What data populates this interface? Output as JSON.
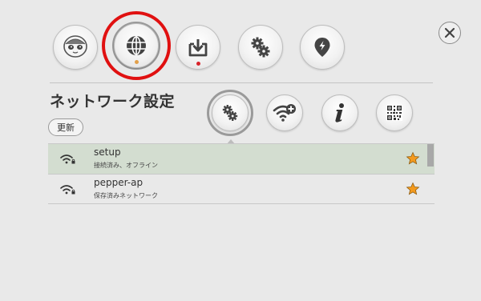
{
  "top_nav": {
    "items": [
      {
        "icon": "robot-face-icon"
      },
      {
        "icon": "globe-icon"
      },
      {
        "icon": "download-icon"
      },
      {
        "icon": "gears-icon"
      },
      {
        "icon": "map-pin-bolt-icon"
      }
    ],
    "close_icon": "close-icon"
  },
  "page": {
    "title": "ネットワーク設定"
  },
  "toolbar": {
    "update_label": "更新",
    "icons": [
      "gears-icon",
      "wifi-add-icon",
      "info-icon",
      "qr-code-icon"
    ]
  },
  "networks": [
    {
      "name": "setup",
      "status": "接続済み、オフライン",
      "favorite": true,
      "selected": true
    },
    {
      "name": "pepper-ap",
      "status": "保存済みネットワーク",
      "favorite": true,
      "selected": false
    }
  ],
  "colors": {
    "highlight_ring": "#e01010",
    "selected_row": "#d3ddd0",
    "star": "#f39a1e",
    "active_dot": "#e2a04a",
    "download_dot": "#d8242a"
  }
}
